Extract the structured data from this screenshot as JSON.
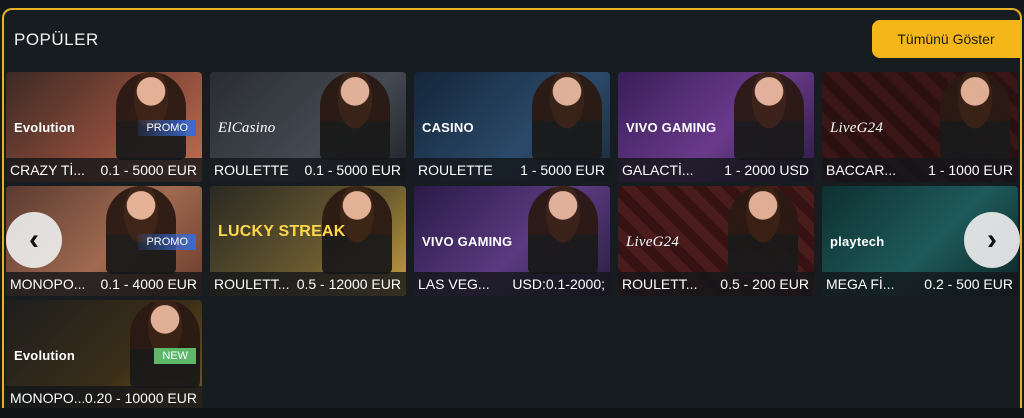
{
  "section": {
    "title": "POPÜLER",
    "show_all_label": "Tümünü Göster",
    "accent": "#f5b61a"
  },
  "tiles": [
    {
      "provider": "Evolution",
      "name": "CRAZY Tİ...",
      "limit": "0.1 - 5000 EUR",
      "badge": "PROMO",
      "theme": "#6b3c3c"
    },
    {
      "provider": "ElCasino",
      "name": "ROULETTE",
      "limit": "0.1 - 5000 EUR",
      "badge": "",
      "theme": "#2f3238"
    },
    {
      "provider": "CASINO",
      "name": "ROULETTE",
      "limit": "1 - 5000 EUR",
      "badge": "",
      "theme": "#1d3550"
    },
    {
      "provider": "VIVO GAMING",
      "name": "GALACTİ...",
      "limit": "1 - 2000 USD",
      "badge": "",
      "theme": "#4a2a6a"
    },
    {
      "provider": "LiveG24",
      "name": "BACCAR...",
      "limit": "1 - 1000 EUR",
      "badge": "",
      "theme": "#3a1a1a"
    },
    {
      "provider": "",
      "name": "MONOPO...",
      "limit": "0.1 - 4000 EUR",
      "badge": "PROMO",
      "theme": "#6a3a34"
    },
    {
      "provider": "LUCKY STREAK",
      "name": "ROULETT...",
      "limit": "0.5 - 12000 EUR",
      "badge": "",
      "theme": "#3a3a2a"
    },
    {
      "provider": "VIVO GAMING",
      "name": "LAS VEG...",
      "limit": "USD:0.1-2000;",
      "badge": "",
      "theme": "#3b2560"
    },
    {
      "provider": "LiveG24",
      "name": "ROULETT...",
      "limit": "0.5 - 200 EUR",
      "badge": "",
      "theme": "#4a1c1c"
    },
    {
      "provider": "playtech",
      "name": "MEGA Fİ...",
      "limit": "0.2 - 500 EUR",
      "badge": "",
      "theme": "#0f3a3a"
    },
    {
      "provider": "Evolution",
      "name": "MONOPO...",
      "limit": "0.20 - 10000 EUR",
      "badge": "NEW",
      "theme": "#3a2e18"
    }
  ],
  "nav": {
    "left_icon": "chevron-left-icon",
    "right_icon": "chevron-right-icon"
  }
}
